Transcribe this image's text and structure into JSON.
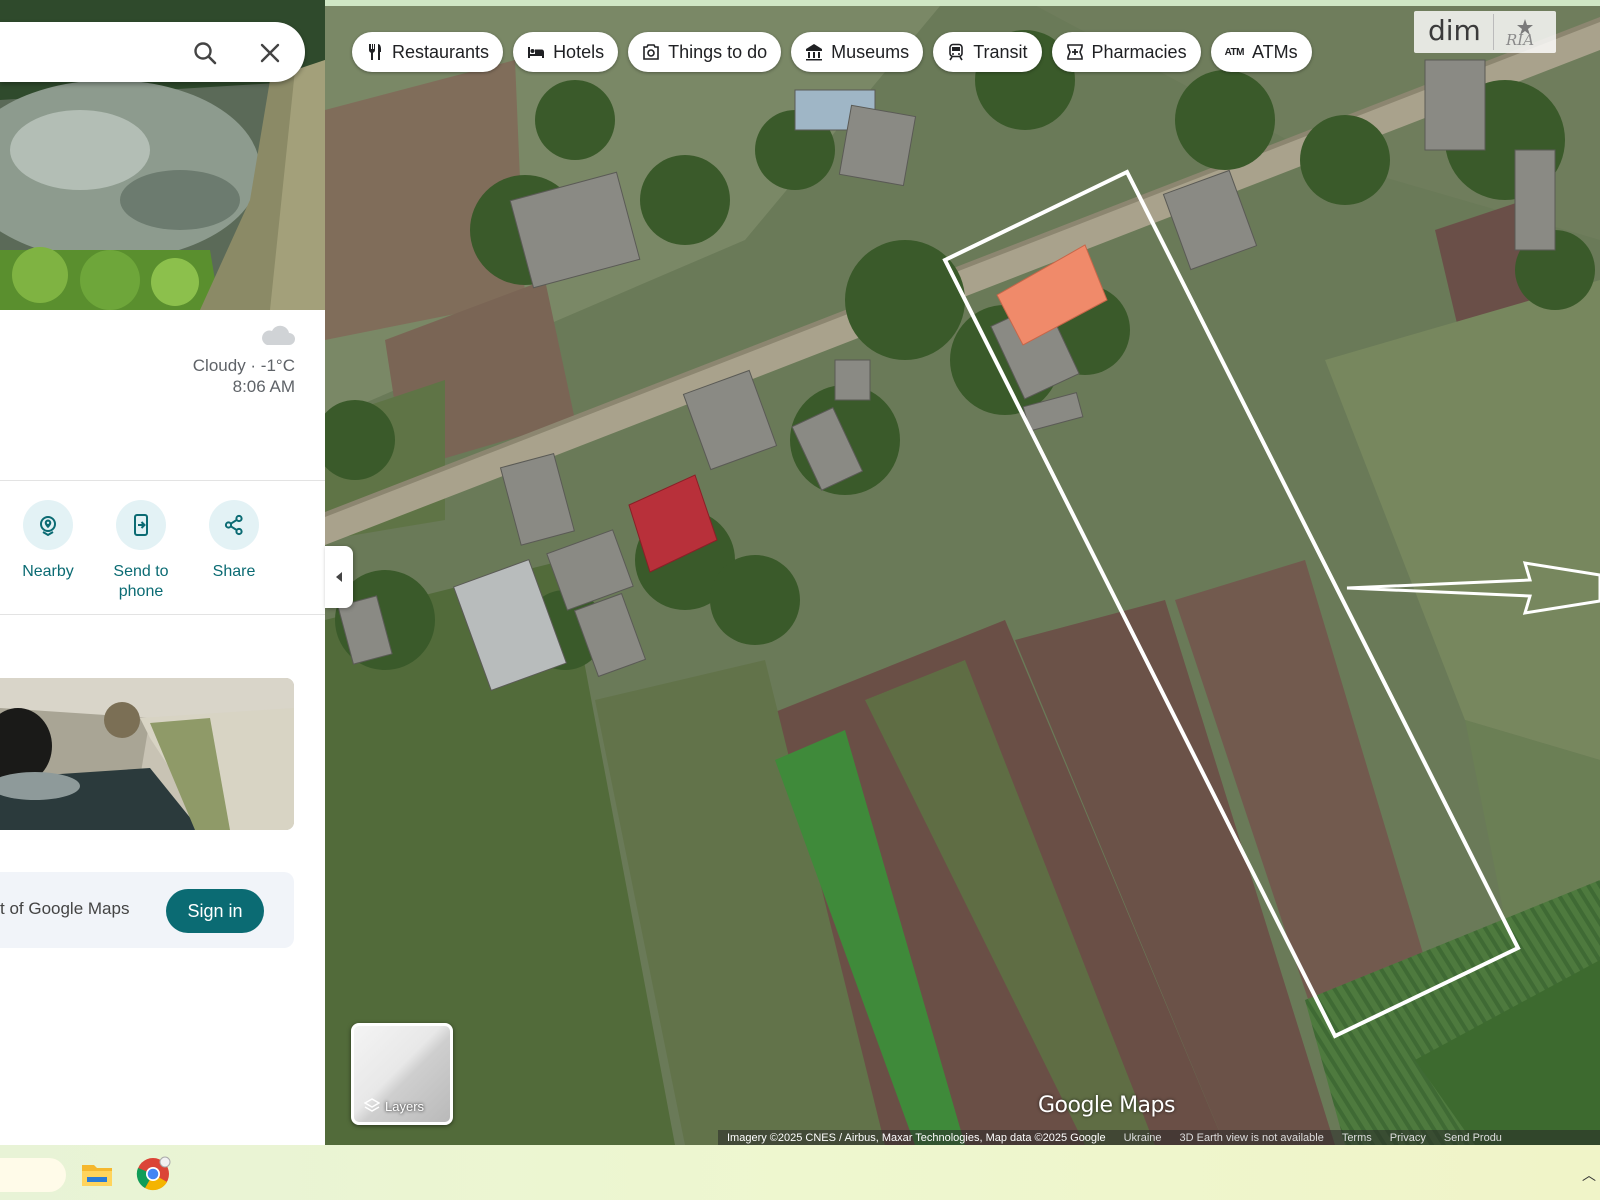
{
  "app": "Google Maps",
  "chips": [
    {
      "label": "Restaurants",
      "icon": "fork-knife-icon"
    },
    {
      "label": "Hotels",
      "icon": "bed-icon"
    },
    {
      "label": "Things to do",
      "icon": "camera-icon"
    },
    {
      "label": "Museums",
      "icon": "museum-icon"
    },
    {
      "label": "Transit",
      "icon": "train-icon"
    },
    {
      "label": "Pharmacies",
      "icon": "pharmacy-icon"
    },
    {
      "label": "ATMs",
      "icon": "atm-icon",
      "glyph": "ATM"
    }
  ],
  "watermark": {
    "text": "dim",
    "mark": "RIA"
  },
  "panel": {
    "weather": {
      "condition": "Cloudy · -1°C",
      "time": "8:06 AM",
      "icon": "cloud-icon"
    },
    "actions": [
      {
        "label": "Nearby",
        "icon": "nearby-icon"
      },
      {
        "label": "Send to phone",
        "icon": "send-to-phone-icon"
      },
      {
        "label": "Share",
        "icon": "share-icon"
      }
    ],
    "signin": {
      "text": "t of Google Maps",
      "button": "Sign in"
    }
  },
  "map": {
    "layers_label": "Layers",
    "logo": "Google Maps",
    "attribution": {
      "imagery": "Imagery ©2025 CNES / Airbus, Maxar Technologies, Map data ©2025 Google",
      "country": "Ukraine",
      "earth": "3D Earth view is not available",
      "terms": "Terms",
      "privacy": "Privacy",
      "send": "Send Produ"
    }
  },
  "colors": {
    "accent": "#0b6b73",
    "accent_light": "#e3f2f5",
    "roof_orange": "#f08a6a",
    "roof_red": "#b8303a"
  }
}
